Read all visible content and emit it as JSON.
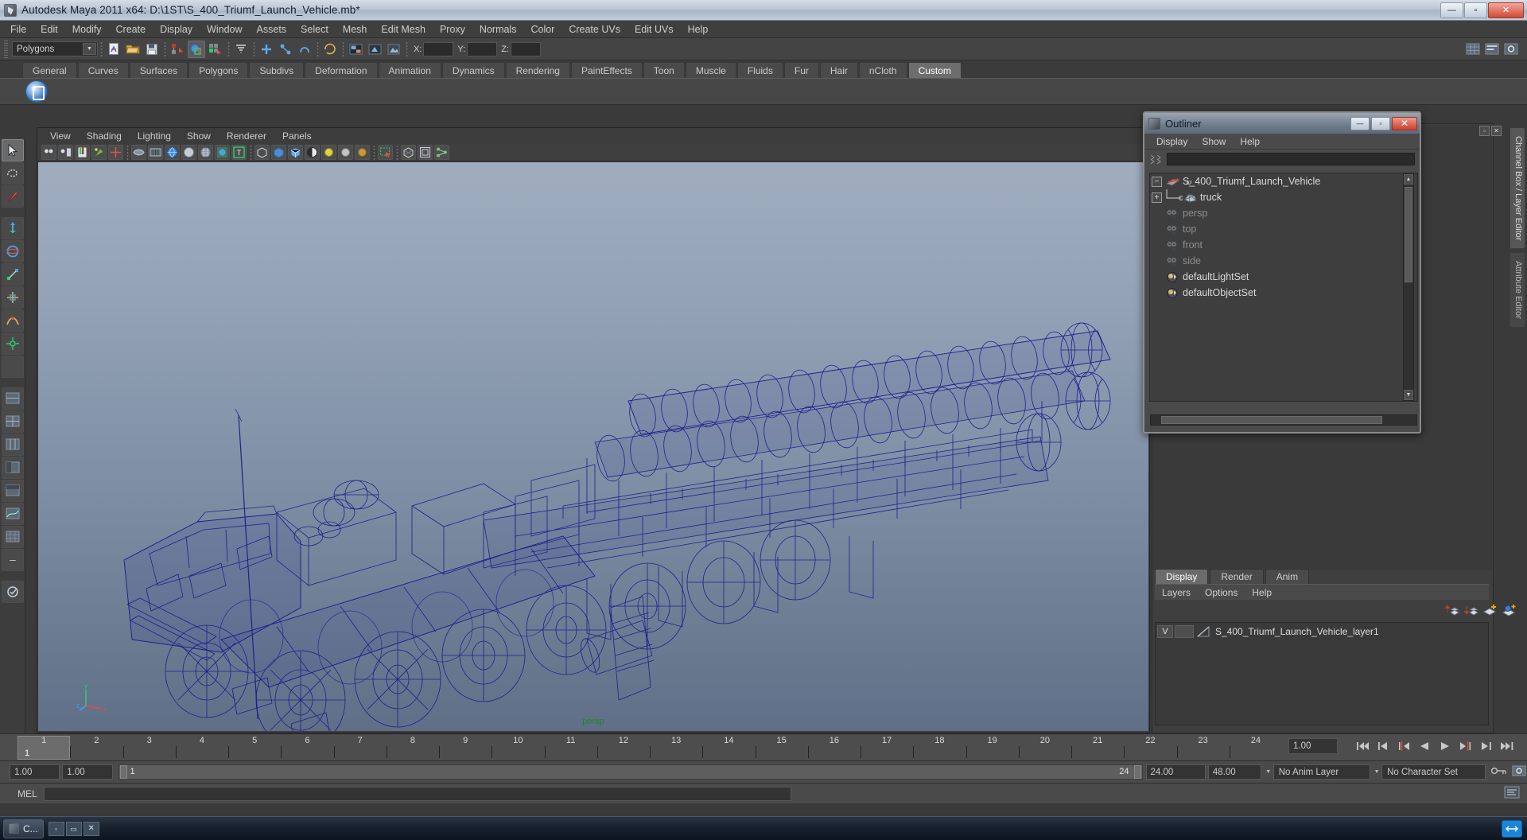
{
  "window": {
    "title": "Autodesk Maya 2011 x64: D:\\1ST\\S_400_Triumf_Launch_Vehicle.mb*",
    "minimize": "—",
    "maximize": "▫",
    "close": "✕"
  },
  "menubar": {
    "items": [
      "File",
      "Edit",
      "Modify",
      "Create",
      "Display",
      "Window",
      "Assets",
      "Select",
      "Mesh",
      "Edit Mesh",
      "Proxy",
      "Normals",
      "Color",
      "Create UVs",
      "Edit UVs",
      "Help"
    ]
  },
  "statusline": {
    "mode": "Polygons",
    "x_label": "X:",
    "y_label": "Y:",
    "z_label": "Z:"
  },
  "shelf": {
    "tabs": [
      "General",
      "Curves",
      "Surfaces",
      "Polygons",
      "Subdivs",
      "Deformation",
      "Animation",
      "Dynamics",
      "Rendering",
      "PaintEffects",
      "Toon",
      "Muscle",
      "Fluids",
      "Fur",
      "Hair",
      "nCloth",
      "Custom"
    ],
    "active": "Custom"
  },
  "viewport": {
    "menu": [
      "View",
      "Shading",
      "Lighting",
      "Show",
      "Renderer",
      "Panels"
    ],
    "camera_label": "persp",
    "axis": {
      "y": "y",
      "x": "x",
      "z": "z"
    },
    "wireframe_color": "#1c1c8c",
    "bg_top": "#9fadbf",
    "bg_bottom": "#5f6f87"
  },
  "outliner": {
    "title": "Outliner",
    "menu": [
      "Display",
      "Show",
      "Help"
    ],
    "minimize": "—",
    "maximize": "▫",
    "close": "✕",
    "items": [
      {
        "label": "S_400_Triumf_Launch_Vehicle",
        "expander": "−",
        "icon": "transform-icon",
        "dim": false,
        "child": false
      },
      {
        "label": "truck",
        "expander": "+",
        "icon": "mesh-icon",
        "dim": false,
        "child": true
      },
      {
        "label": "persp",
        "expander": "",
        "icon": "camera-icon",
        "dim": true,
        "child": false
      },
      {
        "label": "top",
        "expander": "",
        "icon": "camera-icon",
        "dim": true,
        "child": false
      },
      {
        "label": "front",
        "expander": "",
        "icon": "camera-icon",
        "dim": true,
        "child": false
      },
      {
        "label": "side",
        "expander": "",
        "icon": "camera-icon",
        "dim": true,
        "child": false
      },
      {
        "label": "defaultLightSet",
        "expander": "",
        "icon": "set-icon",
        "dim": false,
        "child": false
      },
      {
        "label": "defaultObjectSet",
        "expander": "",
        "icon": "set-icon",
        "dim": false,
        "child": false
      }
    ]
  },
  "channelbox": {
    "tabs": [
      "Channel Box / Layer Editor",
      "Attribute Editor"
    ],
    "active": "Channel Box / Layer Editor"
  },
  "layereditor": {
    "tabs": [
      "Display",
      "Render",
      "Anim"
    ],
    "active": "Display",
    "submenu": [
      "Layers",
      "Options",
      "Help"
    ],
    "layers": [
      {
        "visibility": "V",
        "playback": "",
        "name": "S_400_Triumf_Launch_Vehicle_layer1"
      }
    ]
  },
  "timeslider": {
    "current_frame": "1",
    "tick_labels": [
      "1",
      "2",
      "3",
      "4",
      "5",
      "6",
      "7",
      "8",
      "9",
      "10",
      "11",
      "12",
      "13",
      "14",
      "15",
      "16",
      "17",
      "18",
      "19",
      "20",
      "21",
      "22",
      "23",
      "24"
    ],
    "playback_speed": "1.00",
    "playback_buttons": [
      "go-to-start",
      "step-back-key",
      "step-back-frame",
      "play-backwards",
      "play-forwards",
      "step-forward-frame",
      "step-forward-key",
      "go-to-end"
    ]
  },
  "rangeslider": {
    "anim_start": "1.00",
    "range_start": "1.00",
    "range_bar_start": "1",
    "range_bar_end": "24",
    "range_end": "24.00",
    "anim_end": "48.00",
    "anim_layer": "No Anim Layer",
    "character_set": "No Character Set"
  },
  "commandline": {
    "label": "MEL",
    "input_value": ""
  },
  "taskbar": {
    "items": [
      {
        "label": "C..."
      }
    ],
    "buttons": [
      "▫",
      "▭",
      "✕"
    ]
  }
}
